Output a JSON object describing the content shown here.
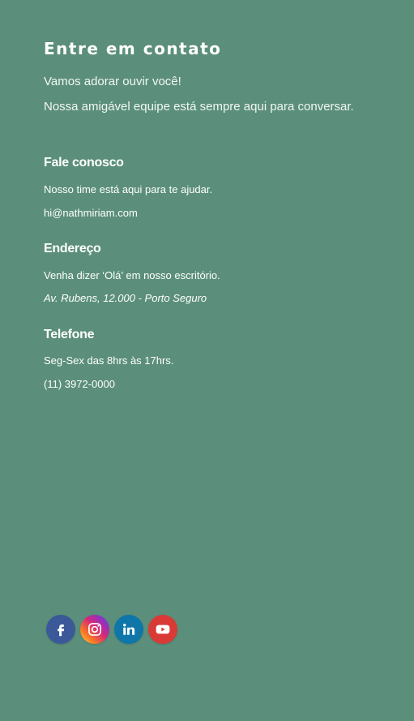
{
  "contact": {
    "title": "Entre em contato",
    "intro_line_1": "Vamos adorar ouvir você!",
    "intro_line_2": "Nossa amigável equipe está sempre aqui para conversar.",
    "blocks": [
      {
        "heading": "Fale conosco",
        "description": "Nosso time está aqui para te ajudar.",
        "detail": "hi@nathmiriam.com"
      },
      {
        "heading": "Endereço",
        "description": "Venha dizer ‘Olá’ em nosso escritório.",
        "detail": "Av. Rubens, 12.000 - Porto Seguro"
      },
      {
        "heading": "Telefone",
        "description": "Seg-Sex das 8hrs às 17hrs.",
        "detail": "(11) 3972-0000"
      }
    ]
  },
  "social": [
    {
      "name": "facebook",
      "icon": "facebook-icon",
      "color": "#3b5998"
    },
    {
      "name": "instagram",
      "icon": "instagram-icon",
      "color": "#d62976"
    },
    {
      "name": "linkedin",
      "icon": "linkedin-icon",
      "color": "#0e76a8"
    },
    {
      "name": "youtube",
      "icon": "youtube-icon",
      "color": "#d93a36"
    }
  ],
  "colors": {
    "background": "#5b8f7b",
    "text": "#ffffff"
  }
}
